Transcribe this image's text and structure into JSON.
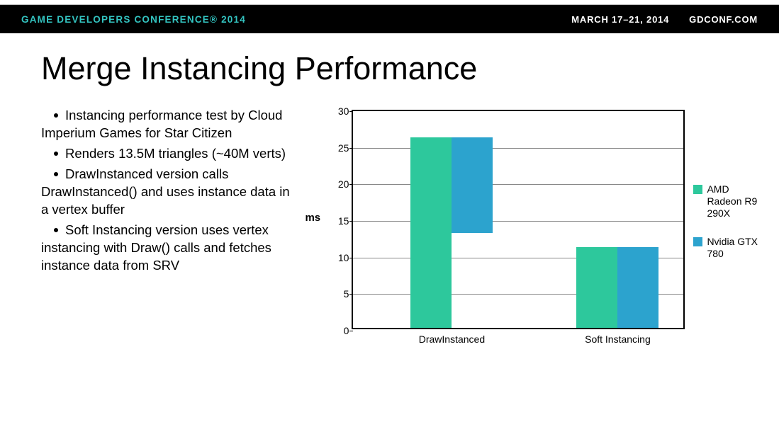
{
  "header": {
    "left": "GAME DEVELOPERS CONFERENCE® 2014",
    "date": "MARCH 17–21, 2014",
    "site": "GDCONF.COM"
  },
  "title": "Merge Instancing Performance",
  "bullets": [
    "Instancing performance test by Cloud Imperium Games for Star Citizen",
    "Renders 13.5M triangles (~40M verts)",
    "DrawInstanced version calls DrawInstanced() and uses instance data in a vertex buffer",
    "Soft Instancing version uses vertex instancing with Draw() calls and fetches instance data from SRV"
  ],
  "chart_data": {
    "type": "bar",
    "categories": [
      "DrawInstanced",
      "Soft Instancing"
    ],
    "series": [
      {
        "name": "AMD Radeon R9 290X",
        "color": "#2dc89c",
        "values": [
          26,
          11
        ]
      },
      {
        "name": "Nvidia GTX 780",
        "color": "#2ca3ce",
        "values": [
          13,
          11
        ]
      }
    ],
    "ylabel": "ms",
    "ylim": [
      0,
      30
    ],
    "ytick": 5,
    "title": "",
    "xlabel": ""
  }
}
